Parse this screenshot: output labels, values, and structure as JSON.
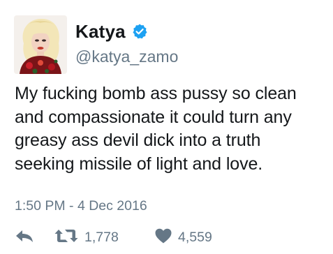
{
  "user": {
    "display_name": "Katya",
    "handle": "@katya_zamo",
    "verified": true,
    "avatar_icon": "profile-avatar"
  },
  "tweet": {
    "text_lines": [
      "My fucking bomb ass pussy so clean",
      "and compassionate it could turn any",
      "greasy ass devil dick into a truth",
      "seeking missile of light and love."
    ],
    "timestamp": "1:50 PM - 4 Dec 2016"
  },
  "actions": {
    "reply_icon": "reply-icon",
    "retweet_icon": "retweet-icon",
    "retweet_count": "1,778",
    "like_icon": "heart-icon",
    "like_count": "4,559"
  },
  "colors": {
    "text": "#14171a",
    "secondary": "#657786",
    "verified_blue": "#1da1f2",
    "background": "#ffffff"
  }
}
